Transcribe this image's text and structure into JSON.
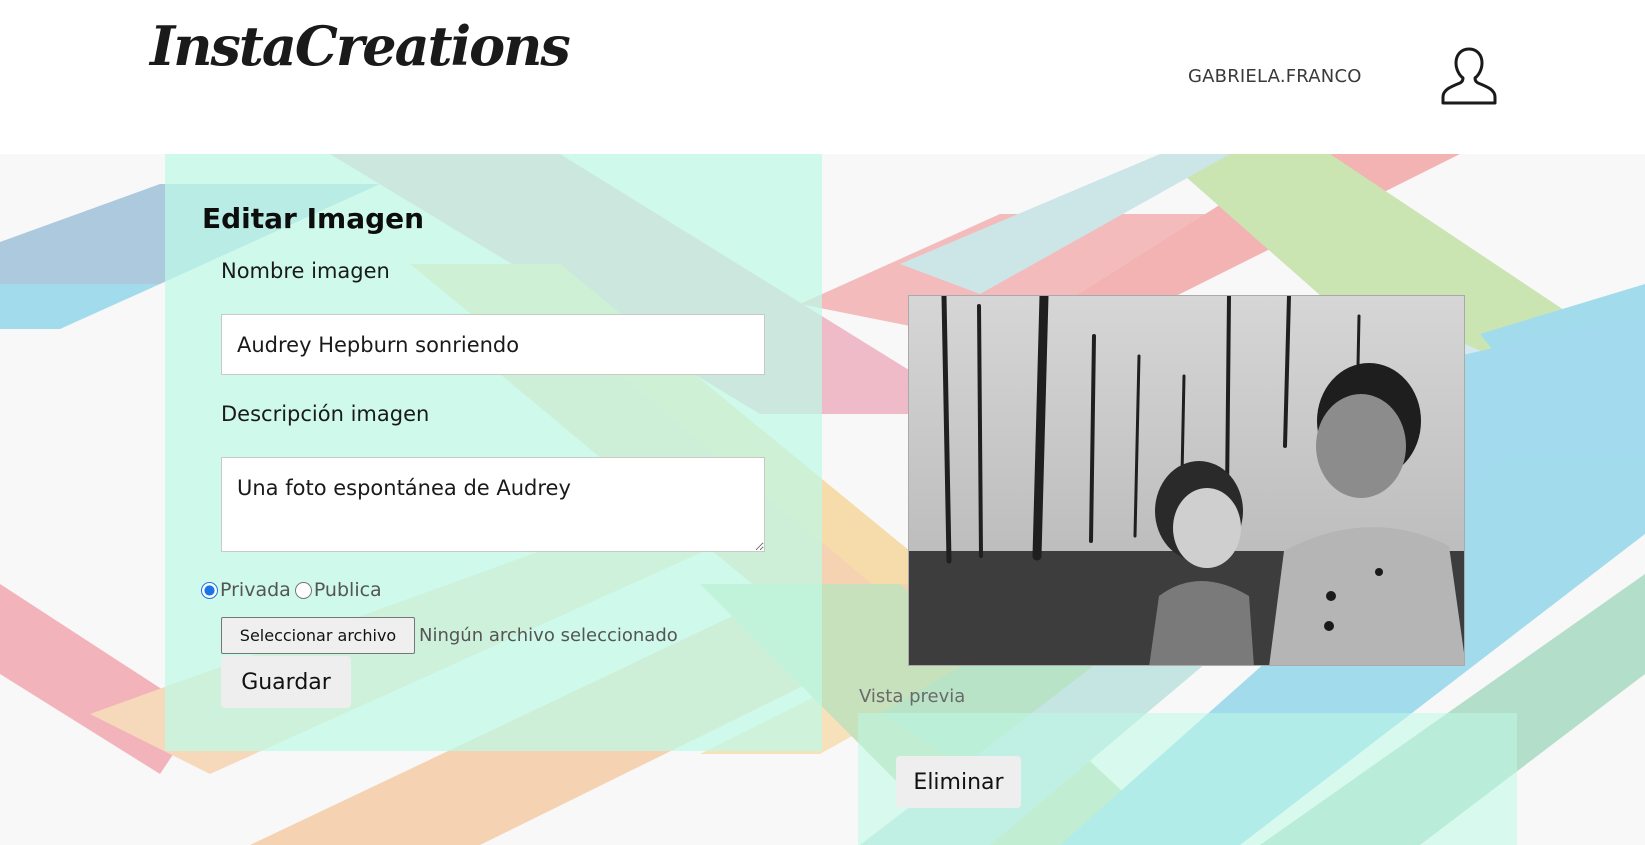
{
  "header": {
    "logo": "InstaCreations",
    "username": "GABRIELA.FRANCO",
    "avatar_icon": "user-avatar-icon"
  },
  "form": {
    "title": "Editar Imagen",
    "name_label": "Nombre imagen",
    "name_value": "Audrey Hepburn sonriendo",
    "description_label": "Descripción imagen",
    "description_value": "Una foto espontánea de Audrey",
    "visibility_options": [
      {
        "label": "Privada",
        "checked": true
      },
      {
        "label": "Publica",
        "checked": false
      }
    ],
    "file_button": "Seleccionar archivo",
    "file_status": "Ningún archivo seleccionado",
    "save_button": "Guardar"
  },
  "preview": {
    "caption": "Vista previa",
    "image_description": "black-and-white photo"
  },
  "actions": {
    "delete_button": "Eliminar"
  },
  "colors": {
    "panel": "#bffae6",
    "radio_accent": "#1a73e8",
    "button_bg": "#eeeeee"
  }
}
